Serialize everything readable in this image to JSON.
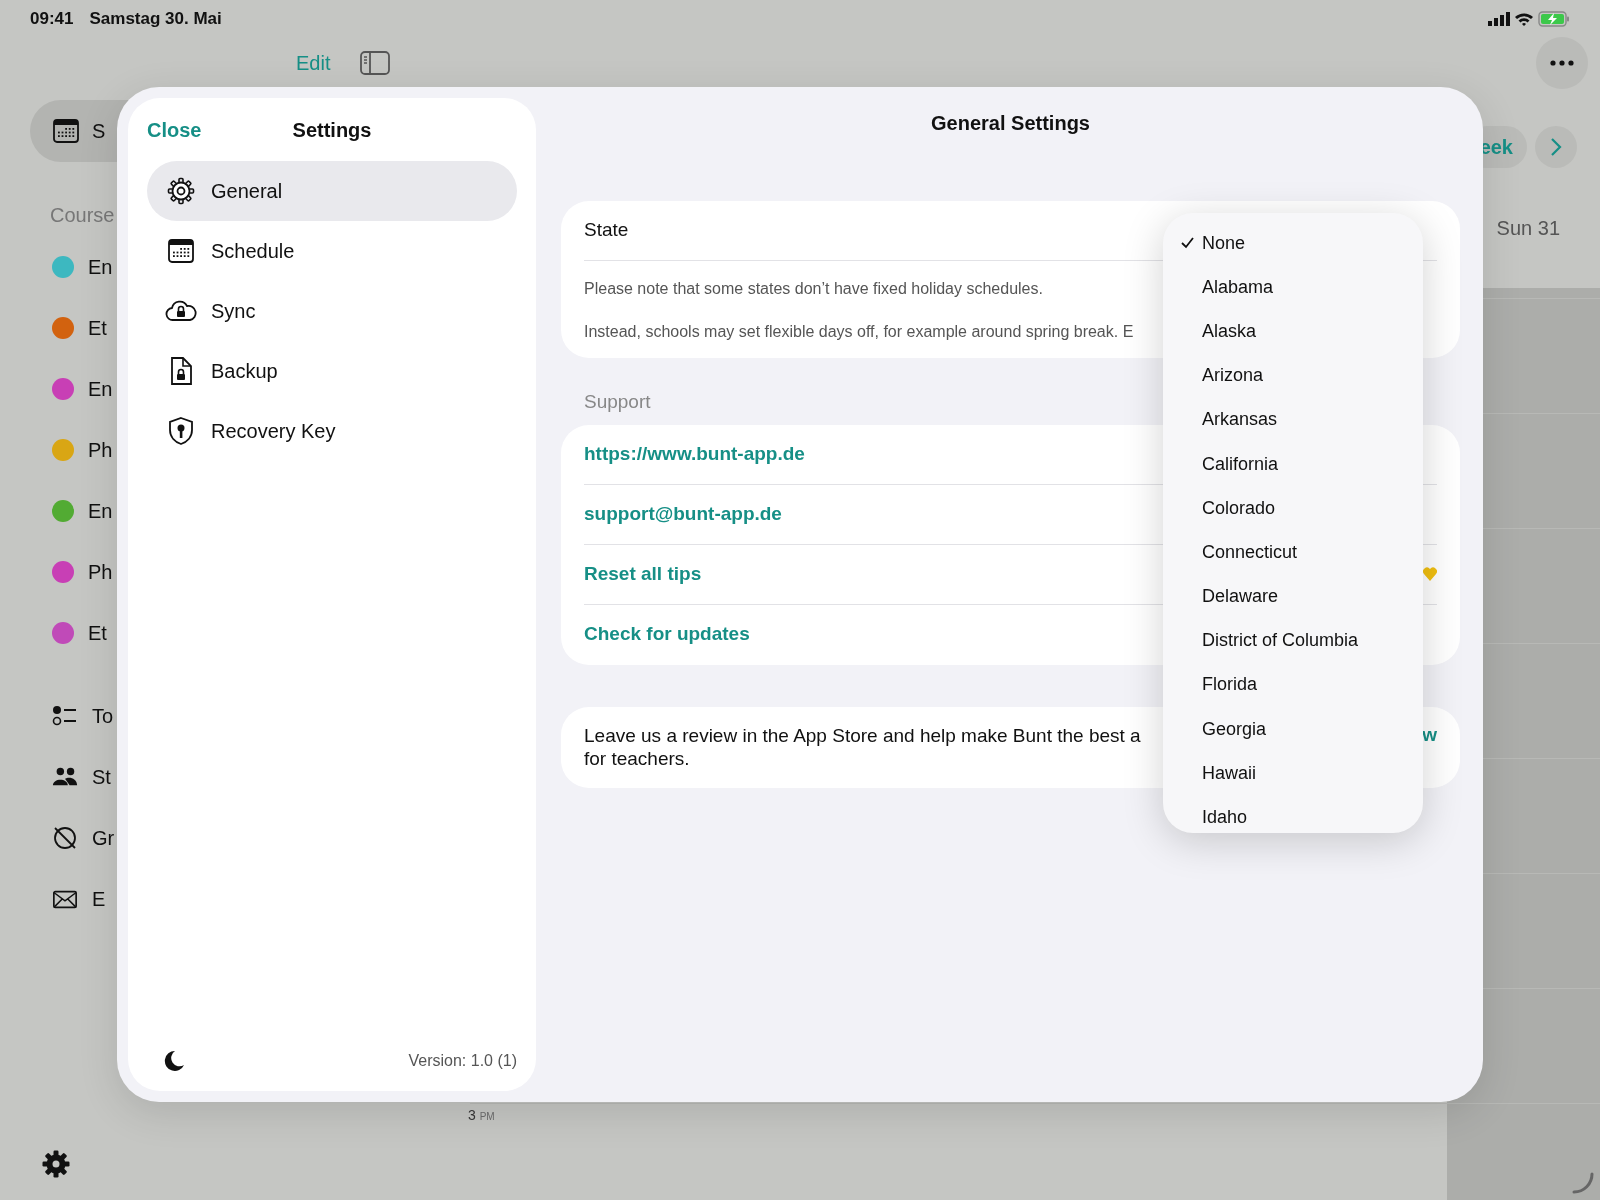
{
  "status_bar": {
    "time": "09:41",
    "date": "Samstag 30. Mai"
  },
  "toolbar": {
    "edit": "Edit"
  },
  "sidebar": {
    "top_item": {
      "label": "S",
      "selected": true
    },
    "section": "Course",
    "courses": [
      {
        "label": "En",
        "color": "#3db8c0"
      },
      {
        "label": "Et",
        "color": "#d2620f"
      },
      {
        "label": "En",
        "color": "#c83fb5"
      },
      {
        "label": "Ph",
        "color": "#d9a614"
      },
      {
        "label": "En",
        "color": "#52ab33"
      },
      {
        "label": "Ph",
        "color": "#c83fb5"
      },
      {
        "label": "Et",
        "color": "#c04ab8"
      }
    ],
    "tools": [
      {
        "label": "To",
        "kind": "todo"
      },
      {
        "label": "St",
        "kind": "students"
      },
      {
        "label": "Gr",
        "kind": "grades"
      },
      {
        "label": "E",
        "kind": "email"
      }
    ]
  },
  "calendar": {
    "week_button": "eek",
    "day_header": "Sun 31",
    "hour_label": "3",
    "hour_suffix": "PM"
  },
  "settings": {
    "close": "Close",
    "title": "Settings",
    "menu": [
      {
        "label": "General",
        "kind": "gear",
        "selected": true
      },
      {
        "label": "Schedule",
        "kind": "calendar",
        "selected": false
      },
      {
        "label": "Sync",
        "kind": "cloud",
        "selected": false
      },
      {
        "label": "Backup",
        "kind": "document",
        "selected": false
      },
      {
        "label": "Recovery Key",
        "kind": "shield",
        "selected": false
      }
    ],
    "version": "Version: 1.0 (1)"
  },
  "general": {
    "title": "General Settings",
    "state": {
      "label": "State",
      "notes": [
        "Please note that some states don’t have fixed holiday schedules.",
        "Instead, schools may set flexible days off, for example around spring break. E"
      ]
    },
    "support": {
      "header": "Support",
      "links": [
        "https://www.bunt-app.de",
        "support@bunt-app.de",
        "Reset all tips",
        "Check for updates"
      ]
    },
    "review": {
      "lines": [
        "Leave us a review in the App Store and help make Bunt the best a",
        "for teachers."
      ],
      "link": "w"
    }
  },
  "state_menu": [
    {
      "label": "None",
      "selected": true
    },
    {
      "label": "Alabama",
      "selected": false
    },
    {
      "label": "Alaska",
      "selected": false
    },
    {
      "label": "Arizona",
      "selected": false
    },
    {
      "label": "Arkansas",
      "selected": false
    },
    {
      "label": "California",
      "selected": false
    },
    {
      "label": "Colorado",
      "selected": false
    },
    {
      "label": "Connecticut",
      "selected": false
    },
    {
      "label": "Delaware",
      "selected": false
    },
    {
      "label": "District of Columbia",
      "selected": false
    },
    {
      "label": "Florida",
      "selected": false
    },
    {
      "label": "Georgia",
      "selected": false
    },
    {
      "label": "Hawaii",
      "selected": false
    },
    {
      "label": "Idaho",
      "selected": false
    }
  ]
}
